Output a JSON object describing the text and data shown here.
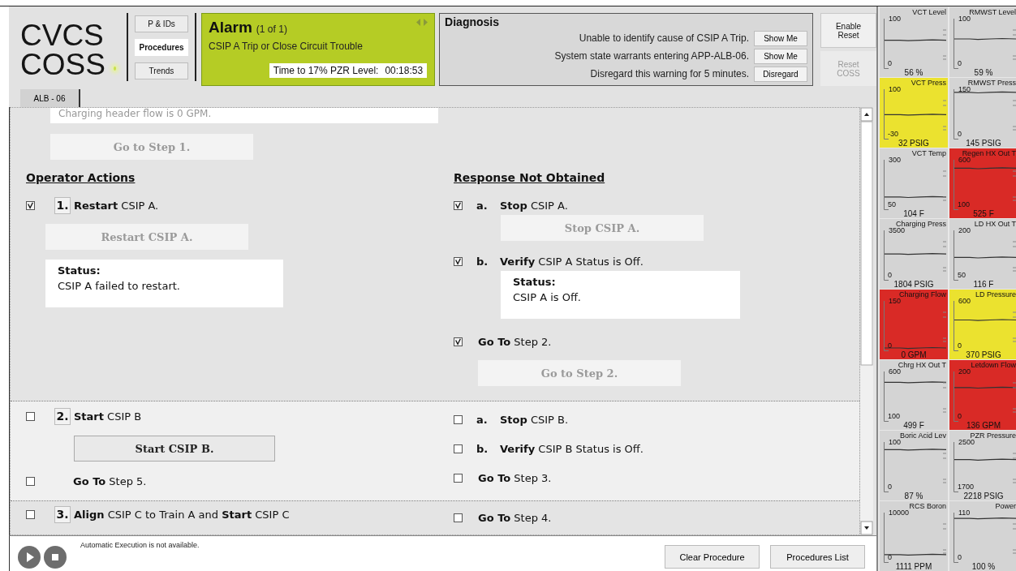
{
  "header": {
    "logo": {
      "line1": "CVCS",
      "line2": "COSS"
    },
    "nav": [
      {
        "label": "P & IDs",
        "selected": false
      },
      {
        "label": "Procedures",
        "selected": true
      },
      {
        "label": "Trends",
        "selected": false
      }
    ],
    "alarm": {
      "title": "Alarm",
      "count": "(1 of 1)",
      "message": "CSIP A Trip or Close Circuit Trouble",
      "timer_label": "Time to 17% PZR Level:",
      "timer_value": "00:18:53"
    },
    "diagnosis": {
      "title": "Diagnosis",
      "rows": [
        {
          "text": "Unable to identify cause of CSIP A Trip.",
          "button": "Show Me"
        },
        {
          "text": "System state warrants entering APP-ALB-06.",
          "button": "Show Me"
        },
        {
          "text": "Disregard this warning for 5 minutes.",
          "button": "Disregard"
        }
      ]
    },
    "reset_buttons": [
      {
        "label": "Enable Reset",
        "disabled": false
      },
      {
        "label": "Reset COSS",
        "disabled": true
      }
    ]
  },
  "procedure_tabs": [
    {
      "label": "ALB - 06",
      "selected": true
    }
  ],
  "procedure": {
    "previous": {
      "status_text": "Charging header flow is 0 GPM.",
      "button": {
        "label": "Go to Step 1.",
        "disabled": true
      }
    },
    "headings": {
      "actions": "Operator Actions",
      "rno": "Response Not Obtained"
    },
    "steps": [
      {
        "number": "1.",
        "checked": true,
        "selected": false,
        "text": "**Restart** CSIP A.",
        "button": {
          "label": "Restart CSIP A.",
          "disabled": true
        },
        "status": {
          "label": "Status:",
          "text": "CSIP A failed to restart."
        },
        "rno": [
          {
            "kind": "substep",
            "letter": "a.",
            "checked": true,
            "text": "**Stop** CSIP A.",
            "button": {
              "label": "Stop CSIP A.",
              "disabled": true
            }
          },
          {
            "kind": "substep",
            "letter": "b.",
            "checked": true,
            "text": "**Verify** CSIP A Status is Off.",
            "status": {
              "label": "Status:",
              "text": "CSIP A is Off."
            }
          },
          {
            "kind": "goto",
            "checked": true,
            "text": "**Go To** Step 2.",
            "button": {
              "label": "Go to Step 2.",
              "disabled": true
            }
          }
        ]
      },
      {
        "number": "2.",
        "checked": false,
        "selected": true,
        "text": "**Start** CSIP B",
        "button": {
          "label": "Start CSIP B.",
          "disabled": false
        },
        "followups": [
          {
            "kind": "goto",
            "checked": false,
            "text": "**Go To** Step 5."
          }
        ],
        "rno": [
          {
            "kind": "substep",
            "letter": "a.",
            "checked": false,
            "text": "**Stop** CSIP B."
          },
          {
            "kind": "substep",
            "letter": "b.",
            "checked": false,
            "text": "**Verify** CSIP B Status is Off."
          },
          {
            "kind": "goto",
            "checked": false,
            "text": "**Go To** Step 3."
          }
        ]
      },
      {
        "number": "3.",
        "checked": false,
        "selected": false,
        "text": "**Align** CSIP C to Train A and **Start** CSIP C",
        "rno": [
          {
            "kind": "goto",
            "checked": false,
            "text": "**Go To** Step 4."
          }
        ]
      }
    ]
  },
  "footer": {
    "message": "Automatic Execution is not available.",
    "buttons": [
      "Clear Procedure",
      "Procedures List"
    ]
  },
  "trends": [
    {
      "title": "VCT Level",
      "scale_max": "100",
      "scale_min": "0",
      "value": "56 %",
      "color": "#d4d4d4"
    },
    {
      "title": "RMWST Level",
      "scale_max": "100",
      "scale_min": "0",
      "value": "59 %",
      "color": "#d4d4d4"
    },
    {
      "title": "VCT Press",
      "scale_max": "100",
      "scale_min": "-30",
      "value": "32 PSIG",
      "color": "#ebe22f"
    },
    {
      "title": "RMWST Press",
      "scale_max": "150",
      "scale_min": "0",
      "value": "145 PSIG",
      "color": "#d4d4d4"
    },
    {
      "title": "VCT Temp",
      "scale_max": "300",
      "scale_min": "50",
      "value": "104 F",
      "color": "#d4d4d4"
    },
    {
      "title": "Regen HX Out T",
      "scale_max": "600",
      "scale_min": "100",
      "value": "525 F",
      "color": "#d92a26"
    },
    {
      "title": "Charging Press",
      "scale_max": "3500",
      "scale_min": "0",
      "value": "1804 PSIG",
      "color": "#d4d4d4"
    },
    {
      "title": "LD HX Out T",
      "scale_max": "200",
      "scale_min": "50",
      "value": "116 F",
      "color": "#d4d4d4"
    },
    {
      "title": "Charging Flow",
      "scale_max": "150",
      "scale_min": "0",
      "value": "0 GPM",
      "color": "#d92a26"
    },
    {
      "title": "LD Pressure",
      "scale_max": "600",
      "scale_min": "0",
      "value": "370 PSIG",
      "color": "#ebe22f"
    },
    {
      "title": "Chrg HX Out T",
      "scale_max": "600",
      "scale_min": "100",
      "value": "499 F",
      "color": "#d4d4d4"
    },
    {
      "title": "Letdown Flow",
      "scale_max": "200",
      "scale_min": "0",
      "value": "136 GPM",
      "color": "#d92a26"
    },
    {
      "title": "Boric Acid Lev",
      "scale_max": "100",
      "scale_min": "0",
      "value": "87 %",
      "color": "#d4d4d4"
    },
    {
      "title": "PZR Pressure",
      "scale_max": "2500",
      "scale_min": "1700",
      "value": "2218 PSIG",
      "color": "#d4d4d4"
    },
    {
      "title": "RCS Boron",
      "scale_max": "10000",
      "scale_min": "0",
      "value": "1111 PPM",
      "color": "#d4d4d4"
    },
    {
      "title": "Power",
      "scale_max": "110",
      "scale_min": "0",
      "value": "100 %",
      "color": "#d4d4d4"
    }
  ]
}
